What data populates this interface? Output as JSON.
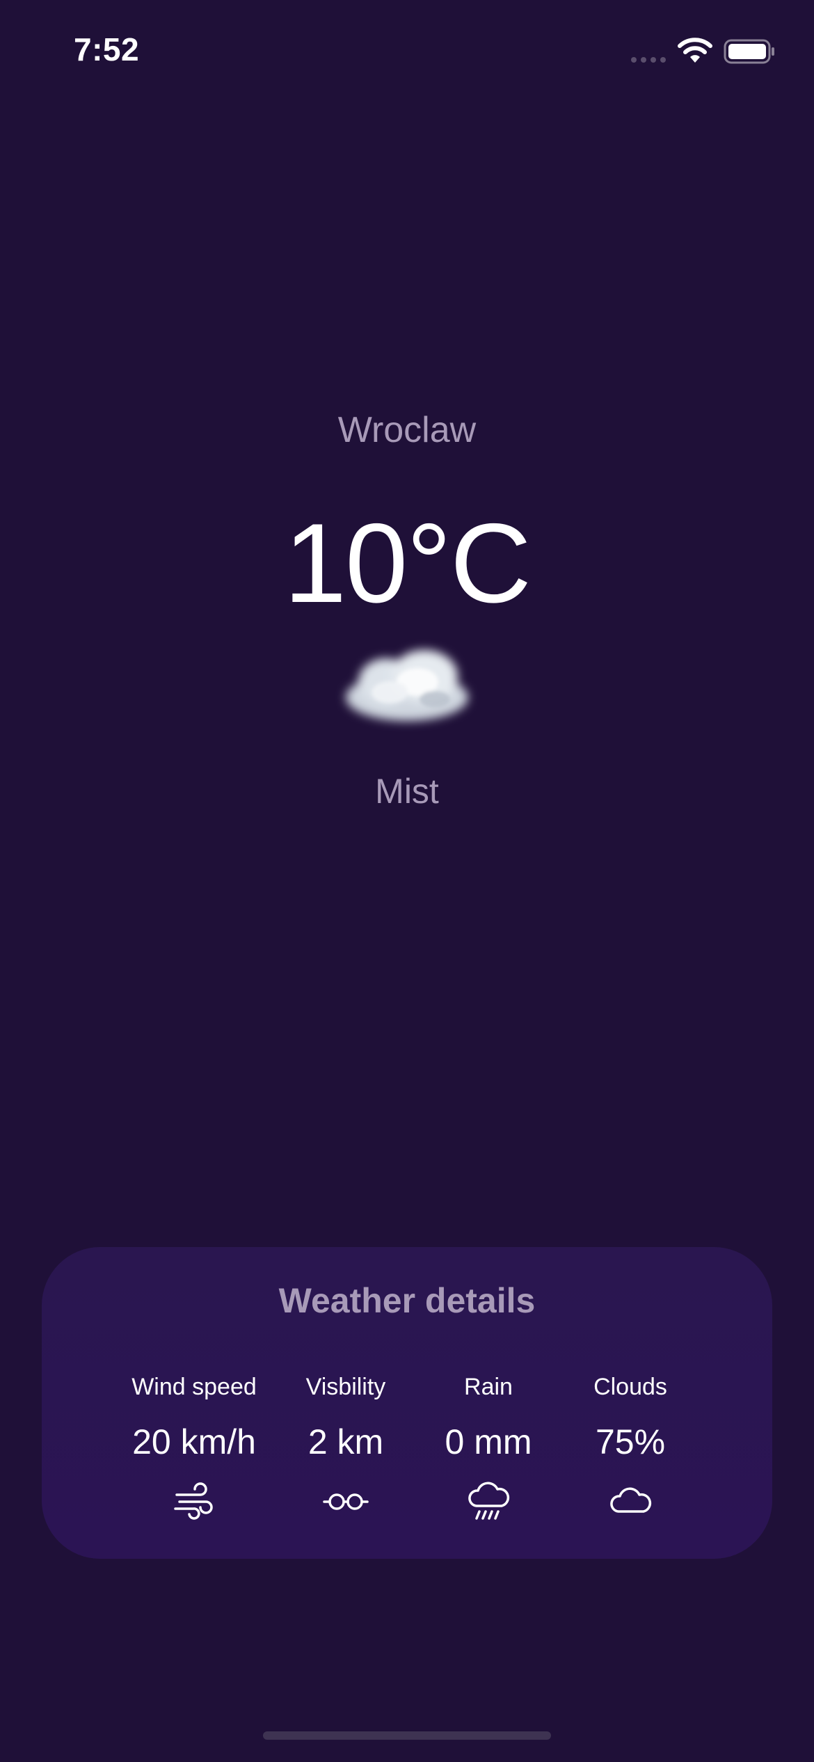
{
  "status_bar": {
    "time": "7:52",
    "icons": [
      "signal-dots-icon",
      "wifi-icon",
      "battery-icon"
    ]
  },
  "weather": {
    "city": "Wroclaw",
    "temperature": "10°C",
    "icon": "mist-cloud-icon",
    "condition": "Mist"
  },
  "details": {
    "title": "Weather details",
    "items": [
      {
        "label": "Wind speed",
        "value": "20 km/h",
        "icon": "wind-icon"
      },
      {
        "label": "Visbility",
        "value": "2 km",
        "icon": "glasses-icon"
      },
      {
        "label": "Rain",
        "value": "0 mm",
        "icon": "rain-cloud-icon"
      },
      {
        "label": "Clouds",
        "value": "75%",
        "icon": "cloud-icon"
      }
    ]
  },
  "colors": {
    "background": "#1f1038",
    "card": "#2b1454",
    "muted_text": "#a89ab8",
    "text": "#ffffff"
  }
}
